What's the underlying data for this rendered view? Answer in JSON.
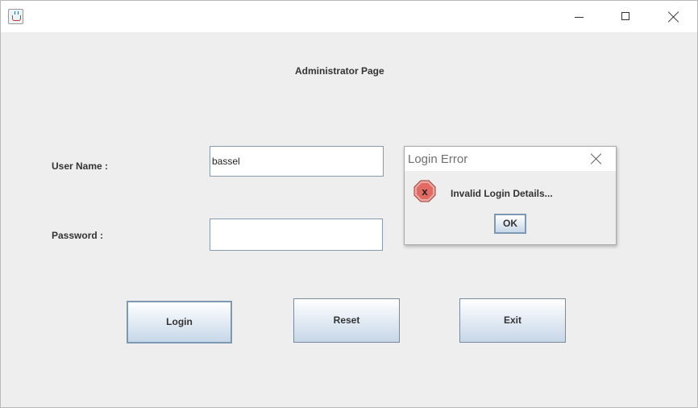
{
  "window": {
    "icon": "java-cup-icon",
    "controls": {
      "minimize": "minimize-icon",
      "maximize": "maximize-icon",
      "close": "close-icon"
    }
  },
  "page": {
    "heading": "Administrator Page"
  },
  "form": {
    "username_label": "User Name :",
    "username_value": "bassel",
    "password_label": "Password :",
    "password_value": ""
  },
  "buttons": {
    "login": "Login",
    "reset": "Reset",
    "exit": "Exit"
  },
  "dialog": {
    "title": "Login Error",
    "message": "Invalid Login Details...",
    "icon": "error-icon",
    "ok_label": "OK"
  },
  "colors": {
    "background": "#eeeeee",
    "button_gradient_bottom": "#c6d7e8",
    "error_red": "#d9534f"
  }
}
